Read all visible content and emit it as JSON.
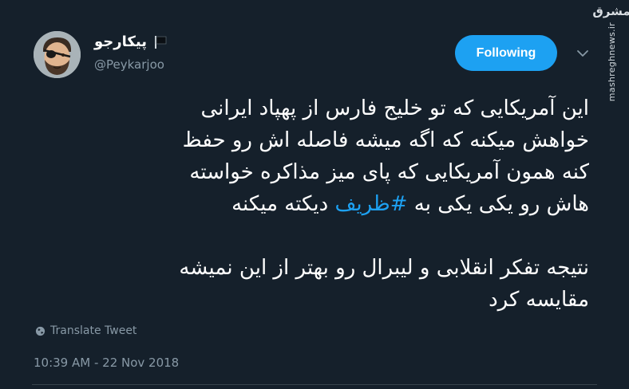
{
  "author": {
    "display_name": "پیکارجو",
    "handle": "@Peykarjoo"
  },
  "follow_button": {
    "label": "Following"
  },
  "watermark": {
    "logo_text": "مشرق",
    "domain": "mashreghnews.ir"
  },
  "tweet": {
    "text_line_1": "این آمریکایی که تو خلیج فارس از پهپاد ایرانی",
    "text_line_2": "خواهش میکنه که اگه میشه فاصله اش رو حفظ",
    "text_line_3": "کنه همون آمریکایی که پای میز مذاکره خواسته",
    "text_line_4_start": "هاش رو یکی یکی به ",
    "hashtag": "#ظریف",
    "text_line_4_end": " دیکته میکنه",
    "text_line_5": "نتیجه تفکر انقلابی و لیبرال رو بهتر از این نمیشه",
    "text_line_6": "مقایسه کرد"
  },
  "translate": {
    "label": "Translate Tweet"
  },
  "timestamp": "10:39 AM - 22 Nov 2018",
  "colors": {
    "background": "#15202b",
    "accent": "#1da1f2",
    "secondary_text": "#8899a6"
  },
  "icons": {
    "flag": "black-flag-icon",
    "caret": "chevron-down-icon",
    "globe": "globe-icon",
    "avatar": "pirate-avatar"
  }
}
